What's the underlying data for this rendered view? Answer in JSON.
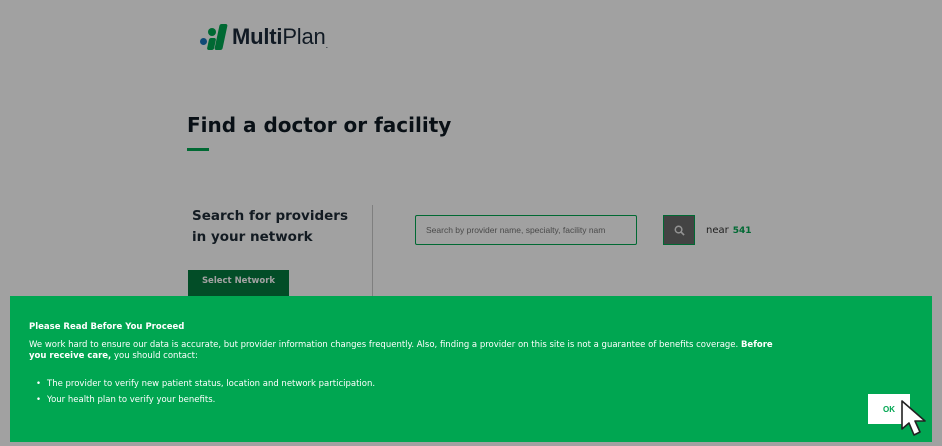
{
  "logo": {
    "brand_bold": "Multi",
    "brand_light": "Plan",
    "mark": "."
  },
  "page": {
    "title": "Find a doctor or facility",
    "search_label": "Search for providers in your network",
    "search_placeholder": "Search by provider name, specialty, facility nam",
    "near_label": "near",
    "near_location": "541",
    "select_network_label": "Select Network"
  },
  "banner": {
    "title": "Please Read Before You Proceed",
    "body_lead": "We work hard to ensure our data is accurate, but provider information changes frequently. Also, finding a provider on this site is not a guarantee of benefits coverage.",
    "body_bold": "Before you receive care,",
    "body_tail": "you should contact:",
    "items": [
      "The provider to verify new patient status, location and network participation.",
      "Your health plan to verify your benefits."
    ],
    "ok_label": "OK"
  },
  "colors": {
    "accent": "#00a651",
    "button_dark": "#047a3e",
    "overlay": "rgba(0,0,0,0.37)"
  },
  "icons": {
    "logo": "multiplan-logo-mark",
    "search": "search-icon",
    "cursor": "mouse-pointer-icon"
  }
}
